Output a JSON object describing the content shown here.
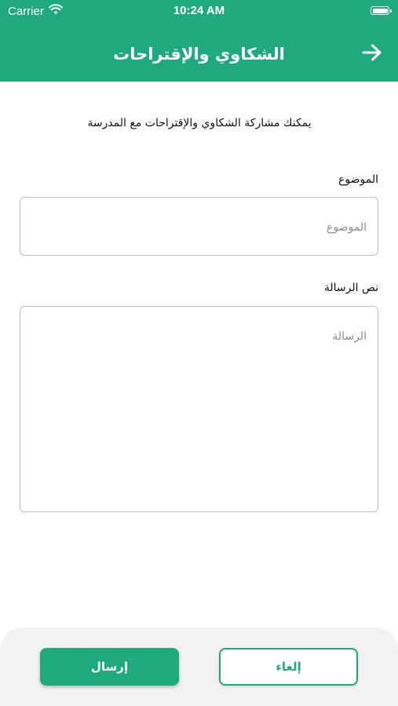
{
  "status_bar": {
    "carrier": "Carrier",
    "time": "10:24 AM",
    "wifi_icon": "wifi-icon",
    "battery_icon": "battery-full-icon"
  },
  "header": {
    "title": "الشكاوي والإقتراحات",
    "back_icon": "arrow-right-icon",
    "background_color": "#1faa7e"
  },
  "intro_text": "يمكنك مشاركة الشكاوي والإقتراحات مع المدرسة",
  "form": {
    "subject": {
      "label": "الموضوع",
      "placeholder": "الموضوع",
      "value": ""
    },
    "message": {
      "label": "نص الرسالة",
      "placeholder": "الرسالة",
      "value": ""
    }
  },
  "actions": {
    "send_label": "إرسال",
    "cancel_label": "إلغاء",
    "accent_color": "#1faa7e"
  }
}
